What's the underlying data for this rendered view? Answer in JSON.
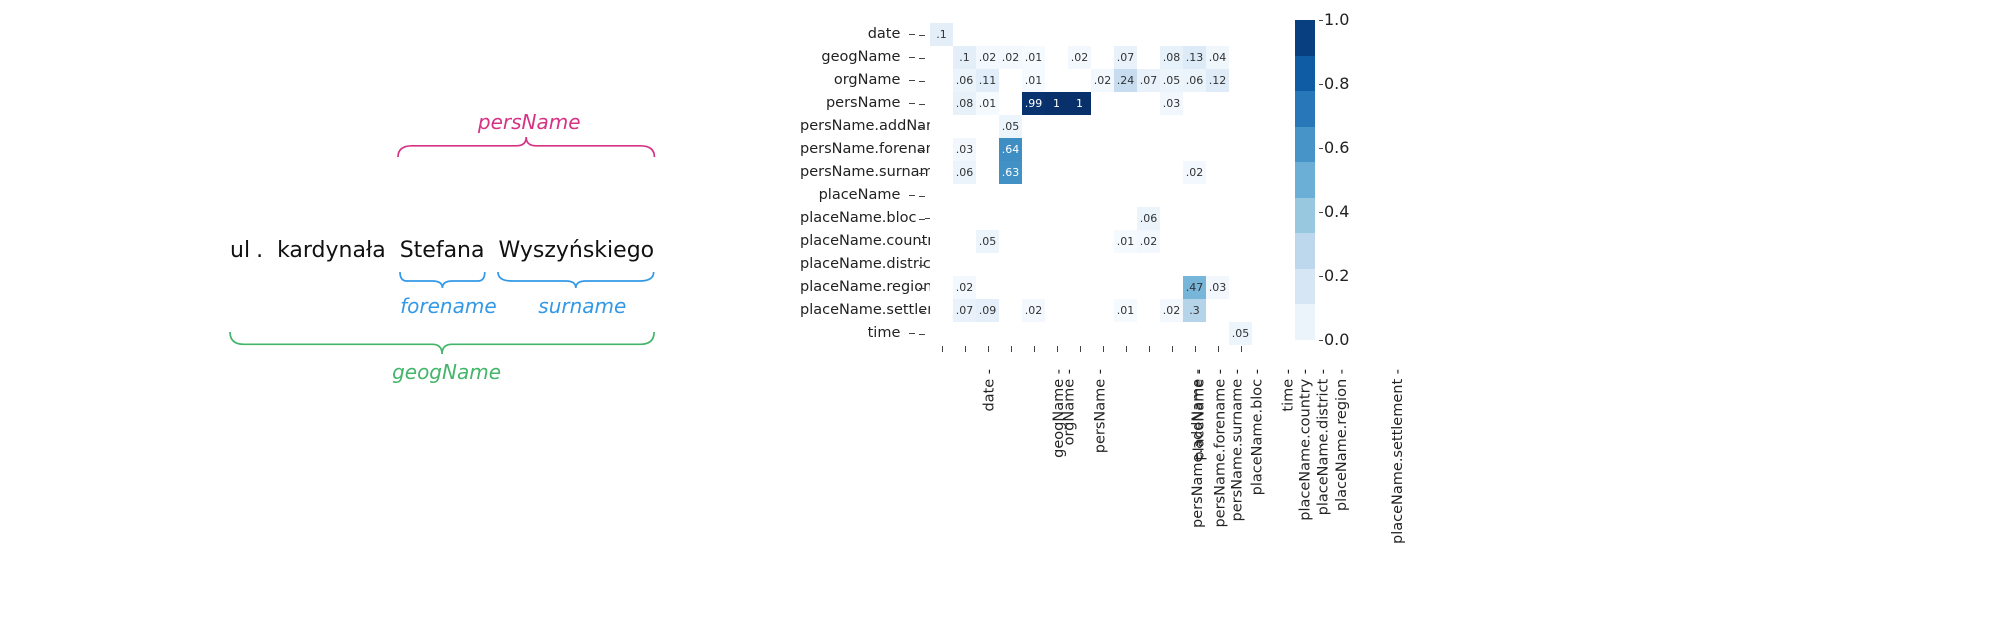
{
  "left": {
    "tokens": [
      "ul",
      ".",
      "kardynała",
      "Stefana",
      "Wyszyńskiego"
    ],
    "labels": {
      "persName": "persName",
      "forename": "forename",
      "surname": "surname",
      "geogName": "geogName"
    }
  },
  "chart_data": {
    "type": "heatmap",
    "rows": [
      "date",
      "geogName",
      "orgName",
      "persName",
      "persName.addName",
      "persName.forename",
      "persName.surname",
      "placeName",
      "placeName.bloc",
      "placeName.country",
      "placeName.district",
      "placeName.region",
      "placeName.settlement",
      "time"
    ],
    "cols": [
      "date",
      "geogName",
      "orgName",
      "persName",
      "persName.addName",
      "persName.forename",
      "persName.surname",
      "placeName",
      "placeName.bloc",
      "placeName.country",
      "placeName.district",
      "placeName.region",
      "placeName.settlement",
      "time"
    ],
    "colorbar_ticks": [
      "0.0",
      "0.2",
      "0.4",
      "0.6",
      "0.8",
      "1.0"
    ],
    "range": [
      0.0,
      1.0
    ],
    "cells": {
      "date": {
        "date": 0.1
      },
      "geogName": {
        "geogName": 0.1,
        "orgName": 0.02,
        "persName": 0.02,
        "persName.addName": 0.01,
        "persName.surname": 0.02,
        "placeName.bloc": 0.07,
        "placeName.district": 0.08,
        "placeName.region": 0.13,
        "placeName.settlement": 0.04
      },
      "orgName": {
        "geogName": 0.06,
        "orgName": 0.11,
        "persName.addName": 0.01,
        "placeName": 0.02,
        "placeName.bloc": 0.24,
        "placeName.country": 0.07,
        "placeName.district": 0.05,
        "placeName.region": 0.06,
        "placeName.settlement": 0.12
      },
      "persName": {
        "geogName": 0.08,
        "orgName": 0.01,
        "persName.addName": 0.99,
        "persName.forename": 1,
        "persName.surname": 1,
        "placeName.district": 0.03
      },
      "persName.addName": {
        "persName": 0.05
      },
      "persName.forename": {
        "geogName": 0.03,
        "persName": 0.64
      },
      "persName.surname": {
        "geogName": 0.06,
        "persName": 0.63,
        "placeName.region": 0.02
      },
      "placeName": {},
      "placeName.bloc": {
        "placeName.country": 0.06
      },
      "placeName.country": {
        "orgName": 0.05,
        "placeName.bloc": 0.01,
        "placeName.country": 0.02
      },
      "placeName.district": {},
      "placeName.region": {
        "geogName": 0.02,
        "placeName.region": 0.47,
        "placeName.settlement": 0.03
      },
      "placeName.settlement": {
        "geogName": 0.07,
        "orgName": 0.09,
        "persName.addName": 0.02,
        "placeName.bloc": 0.01,
        "placeName.district": 0.02,
        "placeName.region": 0.3
      },
      "time": {
        "time": 0.05
      }
    }
  }
}
